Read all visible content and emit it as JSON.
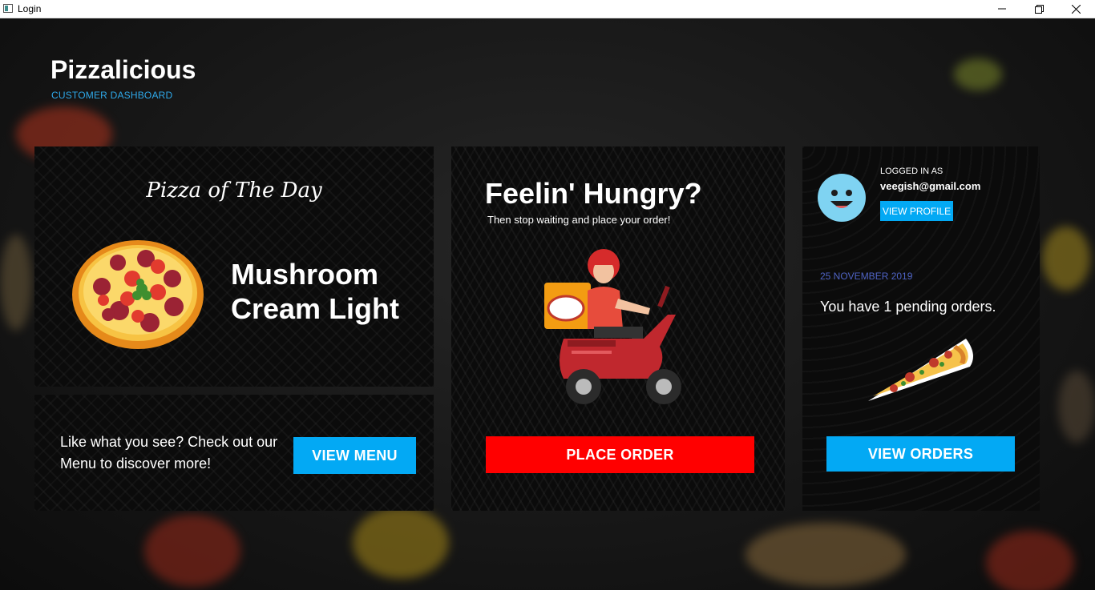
{
  "window": {
    "title": "Login",
    "controls": [
      "minimize-icon",
      "maximize-icon",
      "close-icon"
    ]
  },
  "header": {
    "brand": "Pizzalicious",
    "subtitle": "CUSTOMER DASHBOARD"
  },
  "pizza_of_day": {
    "title": "Pizza of The Day",
    "name": "Mushroom Cream Light",
    "image_icon": "pizza-icon"
  },
  "menu_promo": {
    "text": "Like what you see? Check out our Menu to discover more!",
    "button_label": "VIEW MENU"
  },
  "order_card": {
    "title": "Feelin' Hungry?",
    "subtitle": "Then stop waiting and place your order!",
    "image_icon": "delivery-scooter-icon",
    "button_label": "PLACE ORDER"
  },
  "account_card": {
    "logged_in_label": "LOGGED IN AS",
    "email": "veegish@gmail.com",
    "profile_button_label": "VIEW PROFILE",
    "avatar_icon": "smiley-avatar-icon",
    "date": "25 NOVEMBER 2019",
    "pending_text": "You have 1 pending orders.",
    "image_icon": "pizza-slice-icon",
    "orders_button_label": "VIEW ORDERS"
  },
  "colors": {
    "accent_blue": "#03a9f4",
    "accent_red": "#ff0000",
    "subtitle_blue": "#2fa9ea",
    "date_blue": "#4f63c4"
  }
}
